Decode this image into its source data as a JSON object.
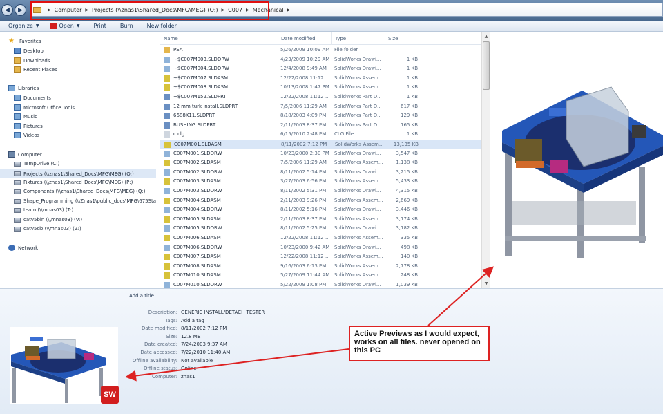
{
  "window": {
    "breadcrumb": [
      "Computer",
      "Projects (\\\\znas1\\Shared_Docs\\MFG\\MEG) (O:)",
      "C007",
      "Mechanical"
    ],
    "nav_back_icon": "back-arrow-icon",
    "nav_forward_icon": "forward-arrow-icon"
  },
  "toolbar": {
    "organize": "Organize",
    "open": "Open",
    "print": "Print",
    "burn": "Burn",
    "new_folder": "New folder"
  },
  "navpane": {
    "favorites": "Favorites",
    "desktop": "Desktop",
    "downloads": "Downloads",
    "recent": "Recent Places",
    "libraries": "Libraries",
    "documents": "Documents",
    "office_tools": "Microsoft Office Tools",
    "music": "Music",
    "pictures": "Pictures",
    "videos": "Videos",
    "computer": "Computer",
    "drives": [
      "TempDrive (C:)",
      "Projects (\\\\znas1\\Shared_Docs\\MFG\\MEG) (O:)",
      "Fixtures (\\\\znas1\\Shared_Docs\\MFG\\MEG) (P:)",
      "Components (\\\\znas1\\Shared_Docs\\MFG\\MEG) (Q:)",
      "Shape_Programming (\\\\Znas1\\public_docs\\MFG\\675Sta",
      "team (\\\\mnas03) (T:)",
      "catv5bin (\\\\mnas03) (V:)",
      "catv5db (\\\\mnas03) (Z:)"
    ],
    "network": "Network"
  },
  "filelist": {
    "headers": {
      "name": "Name",
      "date": "Date modified",
      "type": "Type",
      "size": "Size"
    },
    "rows": [
      {
        "name": "PSA",
        "date": "5/26/2009 10:09 AM",
        "type": "File folder",
        "size": "",
        "icon": "folder"
      },
      {
        "name": "~$C007M003.SLDDRW",
        "date": "4/23/2009 10:29 AM",
        "type": "SolidWorks Drawi...",
        "size": "1 KB",
        "icon": "drw"
      },
      {
        "name": "~$C007M004.SLDDRW",
        "date": "12/4/2008 9:49 AM",
        "type": "SolidWorks Drawi...",
        "size": "1 KB",
        "icon": "drw"
      },
      {
        "name": "~$C007M007.SLDASM",
        "date": "12/22/2008 11:12 ...",
        "type": "SolidWorks Assem...",
        "size": "1 KB",
        "icon": "asm"
      },
      {
        "name": "~$C007M008.SLDASM",
        "date": "10/13/2008 1:47 PM",
        "type": "SolidWorks Assem...",
        "size": "1 KB",
        "icon": "asm"
      },
      {
        "name": "~$C007M152.SLDPRT",
        "date": "12/22/2008 11:12 ...",
        "type": "SolidWorks Part D...",
        "size": "1 KB",
        "icon": "prt"
      },
      {
        "name": "12 mm turk install.SLDPRT",
        "date": "7/5/2006 11:29 AM",
        "type": "SolidWorks Part D...",
        "size": "617 KB",
        "icon": "prt"
      },
      {
        "name": "6688K11.SLDPRT",
        "date": "8/18/2003 4:09 PM",
        "type": "SolidWorks Part D...",
        "size": "129 KB",
        "icon": "prt"
      },
      {
        "name": "BUSHING.SLDPRT",
        "date": "2/11/2003 8:37 PM",
        "type": "SolidWorks Part D...",
        "size": "165 KB",
        "icon": "prt"
      },
      {
        "name": "c.clg",
        "date": "6/15/2010 2:48 PM",
        "type": "CLG File",
        "size": "1 KB",
        "icon": "file"
      },
      {
        "name": "C007M001.SLDASM",
        "date": "8/11/2002 7:12 PM",
        "type": "SolidWorks Assem...",
        "size": "13,135 KB",
        "icon": "asm",
        "selected": true
      },
      {
        "name": "C007M001.SLDDRW",
        "date": "10/23/2000 2:30 PM",
        "type": "SolidWorks Drawi...",
        "size": "3,547 KB",
        "icon": "drw"
      },
      {
        "name": "C007M002.SLDASM",
        "date": "7/5/2006 11:29 AM",
        "type": "SolidWorks Assem...",
        "size": "1,138 KB",
        "icon": "asm"
      },
      {
        "name": "C007M002.SLDDRW",
        "date": "8/11/2002 5:14 PM",
        "type": "SolidWorks Drawi...",
        "size": "3,215 KB",
        "icon": "drw"
      },
      {
        "name": "C007M003.SLDASM",
        "date": "3/27/2003 6:56 PM",
        "type": "SolidWorks Assem...",
        "size": "5,433 KB",
        "icon": "asm"
      },
      {
        "name": "C007M003.SLDDRW",
        "date": "8/11/2002 5:31 PM",
        "type": "SolidWorks Drawi...",
        "size": "4,315 KB",
        "icon": "drw"
      },
      {
        "name": "C007M004.SLDASM",
        "date": "2/11/2003 9:26 PM",
        "type": "SolidWorks Assem...",
        "size": "2,669 KB",
        "icon": "asm"
      },
      {
        "name": "C007M004.SLDDRW",
        "date": "8/11/2002 5:16 PM",
        "type": "SolidWorks Drawi...",
        "size": "3,446 KB",
        "icon": "drw"
      },
      {
        "name": "C007M005.SLDASM",
        "date": "2/11/2003 8:37 PM",
        "type": "SolidWorks Assem...",
        "size": "3,174 KB",
        "icon": "asm"
      },
      {
        "name": "C007M005.SLDDRW",
        "date": "8/11/2002 5:25 PM",
        "type": "SolidWorks Drawi...",
        "size": "3,182 KB",
        "icon": "drw"
      },
      {
        "name": "C007M006.SLDASM",
        "date": "12/22/2008 11:12 ...",
        "type": "SolidWorks Assem...",
        "size": "335 KB",
        "icon": "asm"
      },
      {
        "name": "C007M006.SLDDRW",
        "date": "10/23/2000 9:42 AM",
        "type": "SolidWorks Drawi...",
        "size": "498 KB",
        "icon": "drw"
      },
      {
        "name": "C007M007.SLDASM",
        "date": "12/22/2008 11:12 ...",
        "type": "SolidWorks Assem...",
        "size": "140 KB",
        "icon": "asm"
      },
      {
        "name": "C007M008.SLDASM",
        "date": "9/16/2003 6:13 PM",
        "type": "SolidWorks Assem...",
        "size": "2,778 KB",
        "icon": "asm"
      },
      {
        "name": "C007M010.SLDASM",
        "date": "5/27/2009 11:44 AM",
        "type": "SolidWorks Assem...",
        "size": "248 KB",
        "icon": "asm"
      },
      {
        "name": "C007M010.SLDDRW",
        "date": "5/22/2009 1:08 PM",
        "type": "SolidWorks Drawi...",
        "size": "1,039 KB",
        "icon": "drw"
      }
    ]
  },
  "details": {
    "add_title": "Add a title",
    "props": [
      {
        "label": "Description:",
        "value": "GENERIC INSTALL/DETACH TESTER"
      },
      {
        "label": "Tags:",
        "value": "Add a tag"
      },
      {
        "label": "Date modified:",
        "value": "8/11/2002 7:12 PM"
      },
      {
        "label": "Size:",
        "value": "12.8 MB"
      },
      {
        "label": "Date created:",
        "value": "7/24/2003 9:37 AM"
      },
      {
        "label": "Date accessed:",
        "value": "7/22/2010 11:40 AM"
      },
      {
        "label": "Offline availability:",
        "value": "Not available"
      },
      {
        "label": "Offline status:",
        "value": "Online"
      },
      {
        "label": "Computer:",
        "value": "znas1"
      }
    ],
    "sw_badge": "SW"
  },
  "annotation": {
    "text": "Active Previews as I would expect, works on all files. never opened on this PC",
    "color": "#dd2222"
  }
}
